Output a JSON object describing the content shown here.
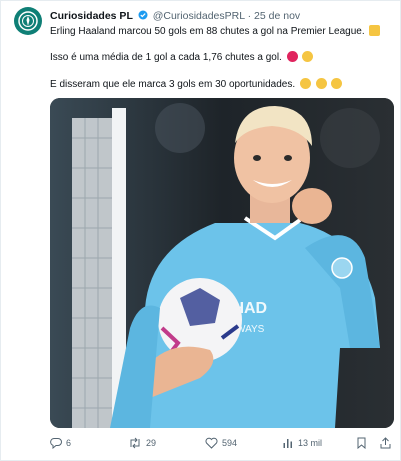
{
  "tweet": {
    "author_name": "Curiosidades PL",
    "handle": "@CuriosidadesPRL",
    "separator": "·",
    "date": "25 de nov",
    "line1": "Erling Haaland marcou 50 gols em 88 chutes a gol na Premier League.",
    "line2": "Isso é uma média de 1 gol a cada 1,76 chutes a gol.",
    "line3": "E disseram que ele marca 3 gols em 30 oportunidades.",
    "image_shirt_text": "ETIHAD AIRWAYS"
  },
  "actions": {
    "replies": "6",
    "retweets": "29",
    "likes": "594",
    "views": "13 mil"
  },
  "icons": [
    "reply-icon",
    "retweet-icon",
    "like-icon",
    "views-icon",
    "bookmark-icon",
    "share-icon"
  ],
  "colors": {
    "accent": "#1d9bf0",
    "muted": "#536471",
    "shirt": "#6cc3ea"
  }
}
